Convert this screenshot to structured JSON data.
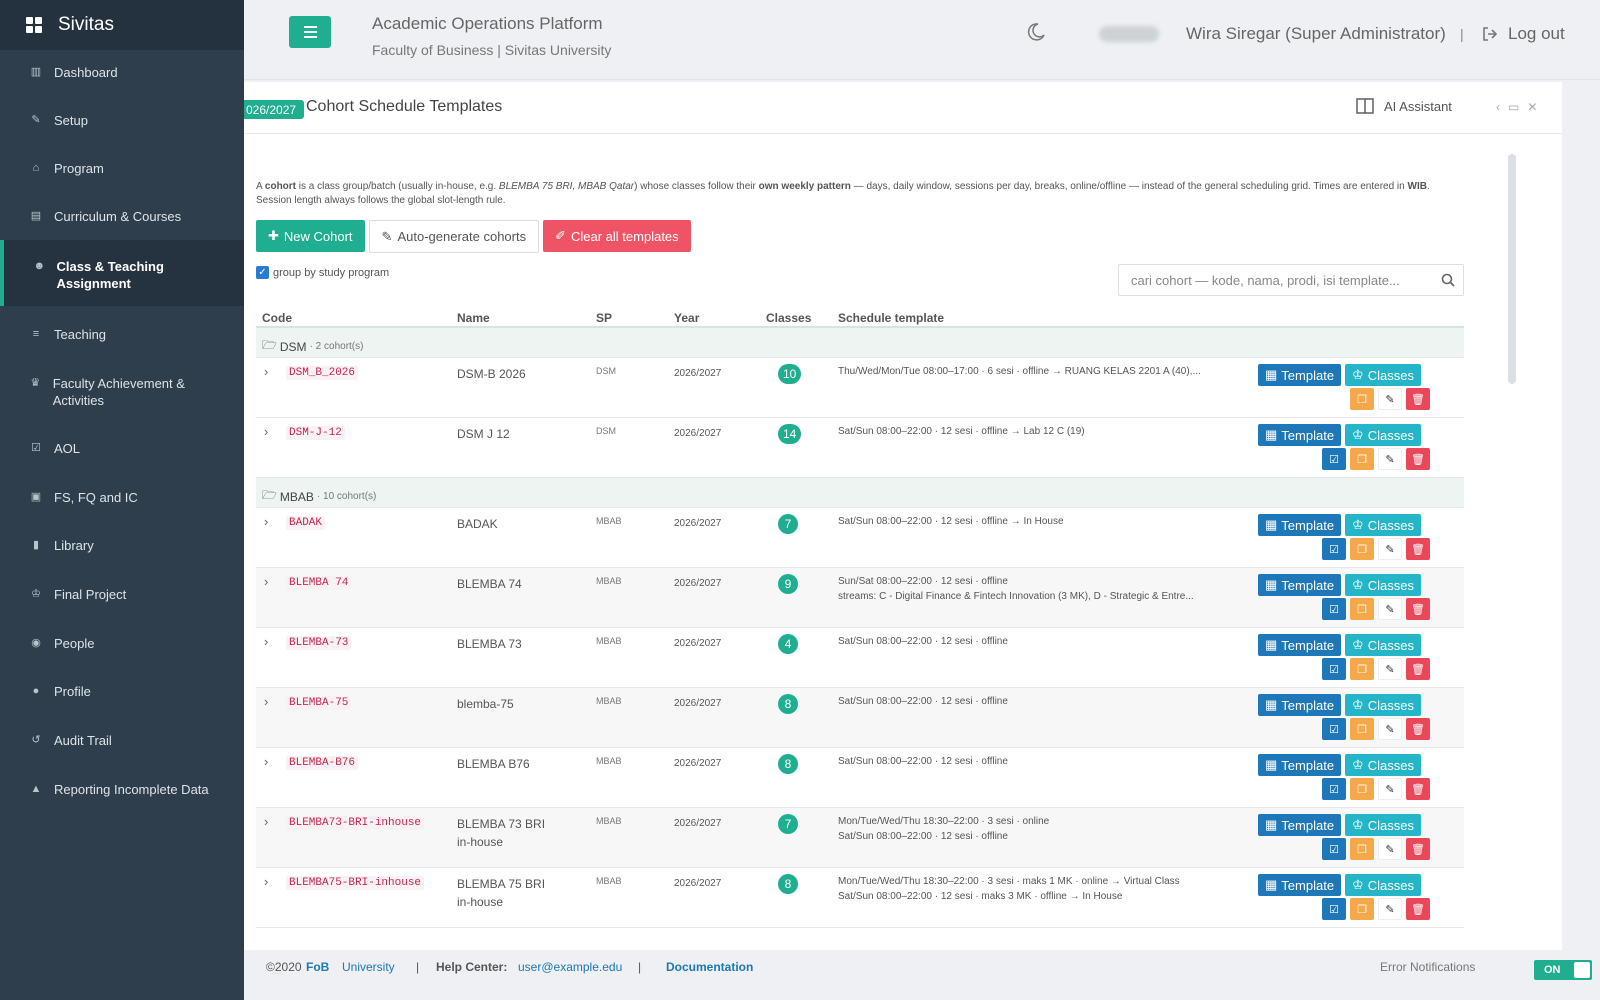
{
  "brand": {
    "name": "Sivitas"
  },
  "sidebar": {
    "items": [
      {
        "label": "Dashboard",
        "icon": "chart-icon"
      },
      {
        "label": "Setup",
        "icon": "wrench-icon"
      },
      {
        "label": "Program",
        "icon": "building-icon"
      },
      {
        "label": "Curriculum & Courses",
        "icon": "file-icon"
      },
      {
        "label": "Class & Teaching Assignment",
        "icon": "users-icon"
      },
      {
        "label": "Teaching",
        "icon": "list-icon"
      },
      {
        "label": "Faculty Achievement & Activities",
        "icon": "trophy-icon"
      },
      {
        "label": "AOL",
        "icon": "check-icon"
      },
      {
        "label": "FS, FQ and IC",
        "icon": "card-icon"
      },
      {
        "label": "Library",
        "icon": "book-icon"
      },
      {
        "label": "Final Project",
        "icon": "graduation-icon"
      },
      {
        "label": "People",
        "icon": "user-circle-icon"
      },
      {
        "label": "Profile",
        "icon": "user-icon"
      },
      {
        "label": "Audit Trail",
        "icon": "history-icon"
      },
      {
        "label": "Reporting Incomplete Data",
        "icon": "warning-icon"
      }
    ]
  },
  "header": {
    "title": "Academic Operations Platform",
    "subtitle": "Faculty of Business | Sivitas University",
    "user": "Wira Siregar (Super Administrator)",
    "separator": "|",
    "logout": "Log out"
  },
  "panel": {
    "year_badge": "026/2027",
    "title": "Cohort Schedule Templates",
    "ai_assistant": "AI Assistant"
  },
  "description": {
    "p1": "A ",
    "b1": "cohort",
    "p2": " is a class group/batch (usually in-house, e.g. ",
    "i1": "BLEMBA 75 BRI, MBAB Qatar",
    "p3": ") whose classes follow their ",
    "b2": "own weekly pattern",
    "p4": " — days, daily window, sessions per day, breaks, online/offline — instead of the general scheduling grid. Times are entered in ",
    "b3": "WIB",
    "p5": ". Session length always follows the global slot-length rule."
  },
  "buttons": {
    "new_cohort": "New Cohort",
    "auto_generate": "Auto-generate cohorts",
    "clear_all": "Clear all templates"
  },
  "group_checkbox": {
    "label": "group by study program",
    "checked": true
  },
  "search": {
    "placeholder": "cari cohort — kode, nama, prodi, isi template..."
  },
  "table": {
    "headers": {
      "code": "Code",
      "name": "Name",
      "sp": "SP",
      "year": "Year",
      "classes": "Classes",
      "schedule": "Schedule template"
    },
    "groups": [
      {
        "name": "DSM",
        "count": "· 2 cohort(s)"
      },
      {
        "name": "MBAB",
        "count": "· 10 cohort(s)"
      }
    ],
    "rows": [
      {
        "code": "DSM_B_2026",
        "name": "DSM-B 2026",
        "sp": "DSM",
        "year": "2026/2027",
        "classes": "10",
        "sched1": "Thu/Wed/Mon/Tue 08:00–17:00 · 6 sesi · offline → RUANG KELAS 2201 A (40),...",
        "sched2": ""
      },
      {
        "code": "DSM-J-12",
        "name": "DSM J 12",
        "sp": "DSM",
        "year": "2026/2027",
        "classes": "14",
        "sched1": "Sat/Sun 08:00–22:00 · 12 sesi · offline → Lab 12 C (19)",
        "sched2": ""
      },
      {
        "code": "BADAK",
        "name": "BADAK",
        "sp": "MBAB",
        "year": "2026/2027",
        "classes": "7",
        "sched1": "Sat/Sun 08:00–22:00 · 12 sesi · offline → In House",
        "sched2": ""
      },
      {
        "code": "BLEMBA 74",
        "name": "BLEMBA 74",
        "sp": "MBAB",
        "year": "2026/2027",
        "classes": "9",
        "sched1": "Sun/Sat 08:00–22:00 · 12 sesi · offline",
        "sched2": "streams: C - Digital Finance & Fintech Innovation (3 MK), D - Strategic & Entre..."
      },
      {
        "code": "BLEMBA-73",
        "name": "BLEMBA 73",
        "sp": "MBAB",
        "year": "2026/2027",
        "classes": "4",
        "sched1": "Sat/Sun 08:00–22:00 · 12 sesi · offline",
        "sched2": ""
      },
      {
        "code": "BLEMBA-75",
        "name": "blemba-75",
        "sp": "MBAB",
        "year": "2026/2027",
        "classes": "8",
        "sched1": "Sat/Sun 08:00–22:00 · 12 sesi · offline",
        "sched2": ""
      },
      {
        "code": "BLEMBA-B76",
        "name": "BLEMBA B76",
        "sp": "MBAB",
        "year": "2026/2027",
        "classes": "8",
        "sched1": "Sat/Sun 08:00–22:00 · 12 sesi · offline",
        "sched2": ""
      },
      {
        "code": "BLEMBA73-BRI-inhouse",
        "name": "BLEMBA 73 BRI in-house",
        "sp": "MBAB",
        "year": "2026/2027",
        "classes": "7",
        "sched1": "Mon/Tue/Wed/Thu 18:30–22:00 · 3 sesi · online",
        "sched2": "Sat/Sun 08:00–22:00 · 12 sesi · offline"
      },
      {
        "code": "BLEMBA75-BRI-inhouse",
        "name": "BLEMBA 75 BRI in-house",
        "sp": "MBAB",
        "year": "2026/2027",
        "classes": "8",
        "sched1": "Mon/Tue/Wed/Thu 18:30–22:00 · 3 sesi · maks 1 MK · online → Virtual Class",
        "sched2": "Sat/Sun 08:00–22:00 · 12 sesi · maks 3 MK · offline → In House"
      }
    ],
    "action_labels": {
      "template": "Template",
      "classes": "Classes"
    }
  },
  "footer": {
    "copyright": "©2020",
    "fob": "FoB",
    "university": "University",
    "sep": "|",
    "help_label": "Help Center:",
    "help_email": "user@example.edu",
    "documentation": "Documentation",
    "error_notifications": "Error Notifications",
    "toggle": "ON"
  },
  "colors": {
    "accent": "#1fae8f",
    "sidebar": "#2f3e4c",
    "template_btn": "#1d77b8",
    "classes_btn": "#25b5c9",
    "danger": "#ee5465",
    "warning": "#f4a84a"
  }
}
